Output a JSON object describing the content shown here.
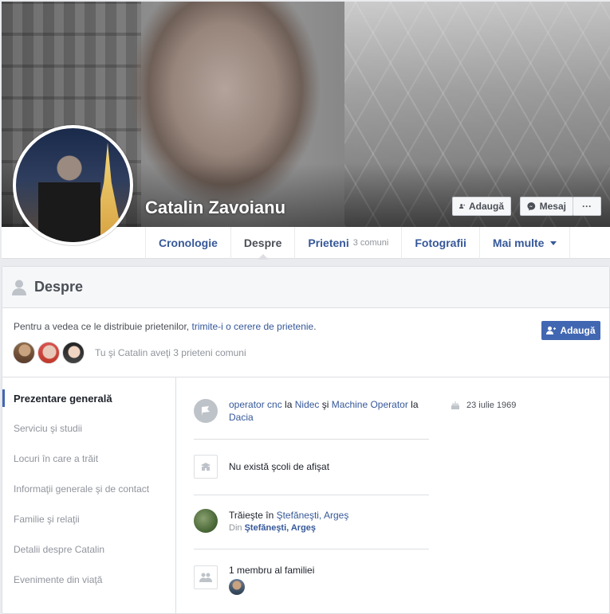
{
  "profile": {
    "name": "Catalin Zavoianu",
    "actions": {
      "add_label": "Adaugă",
      "message_label": "Mesaj",
      "more_label": "···"
    }
  },
  "tabs": [
    {
      "label": "Cronologie",
      "sub": ""
    },
    {
      "label": "Despre",
      "sub": ""
    },
    {
      "label": "Prieteni",
      "sub": "3 comuni"
    },
    {
      "label": "Fotografii",
      "sub": ""
    },
    {
      "label": "Mai multe",
      "sub": ""
    }
  ],
  "about": {
    "title": "Despre",
    "notice_text": "Pentru a vedea ce le distribuie prietenilor,",
    "notice_link": "trimite-i o cerere de prietenie",
    "notice_end": ".",
    "add_label": "Adaugă",
    "mutual_text": "Tu şi Catalin aveţi 3 prieteni comuni"
  },
  "nav": [
    "Prezentare generală",
    "Serviciu şi studii",
    "Locuri în care a trăit",
    "Informaţii generale şi de contact",
    "Familie şi relaţii",
    "Detalii despre Catalin",
    "Evenimente din viaţă"
  ],
  "overview": {
    "work": {
      "role1": "operator cnc",
      "at1": "la",
      "place1": "Nidec",
      "and": "şi",
      "role2": "Machine Operator",
      "at2": "la",
      "place2": "Dacia"
    },
    "school": "Nu există şcoli de afişat",
    "lives": {
      "prefix": "Trăieşte în",
      "city": "Ştefăneşti, Argeş",
      "from_prefix": "Din",
      "from_city": "Ştefăneşti, Argeş"
    },
    "family": "1 membru al familiei",
    "birthday": "23 iulie 1969"
  },
  "icons": {
    "add_friend": "add-friend-icon",
    "messenger": "messenger-icon",
    "person": "person-icon",
    "work": "briefcase-flag-icon",
    "school": "school-icon",
    "family": "family-icon",
    "cake": "birthday-cake-icon"
  },
  "colors": {
    "link": "#365899",
    "button_blue": "#4267b2",
    "muted": "#90949c"
  }
}
